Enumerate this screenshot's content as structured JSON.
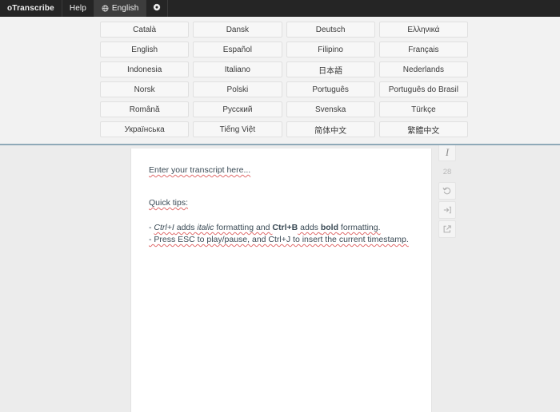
{
  "topbar": {
    "brand": "oTranscribe",
    "help_label": "Help",
    "language_label": "English",
    "globe_icon": "globe-icon",
    "gear_icon": "gear-icon"
  },
  "language_panel": {
    "languages": [
      "Català",
      "Dansk",
      "Deutsch",
      "Ελληνικά",
      "English",
      "Español",
      "Filipino",
      "Français",
      "Indonesia",
      "Italiano",
      "日本語",
      "Nederlands",
      "Norsk",
      "Polski",
      "Português",
      "Português do Brasil",
      "Română",
      "Русский",
      "Svenska",
      "Türkçe",
      "Українська",
      "Tiếng Việt",
      "简体中文",
      "繁體中文"
    ]
  },
  "editor": {
    "placeholder_line": "Enter your transcript here...",
    "tips_heading": "Quick tips:",
    "tip1_prefix": "- ",
    "tip1_key1": "Ctrl+I",
    "tip1_mid1": " adds ",
    "tip1_em": "italic",
    "tip1_mid2": " formatting and ",
    "tip1_key2": "Ctrl+B",
    "tip1_mid3": " adds ",
    "tip1_strong": "bold",
    "tip1_suffix": " formatting.",
    "tip2": "- Press ESC to play/pause, and Ctrl+J to insert the current timestamp."
  },
  "rail": {
    "italic_label": "I",
    "word_count": "28",
    "undo_icon": "undo-icon",
    "timestamp_icon": "insert-timestamp-icon",
    "export_icon": "export-icon"
  },
  "colors": {
    "topbar_bg": "#252525",
    "panel_bg": "#f2f2f2",
    "panel_border": "#8fa9b8",
    "text": "#3a4a55",
    "spellcheck": "#e06c6c"
  }
}
